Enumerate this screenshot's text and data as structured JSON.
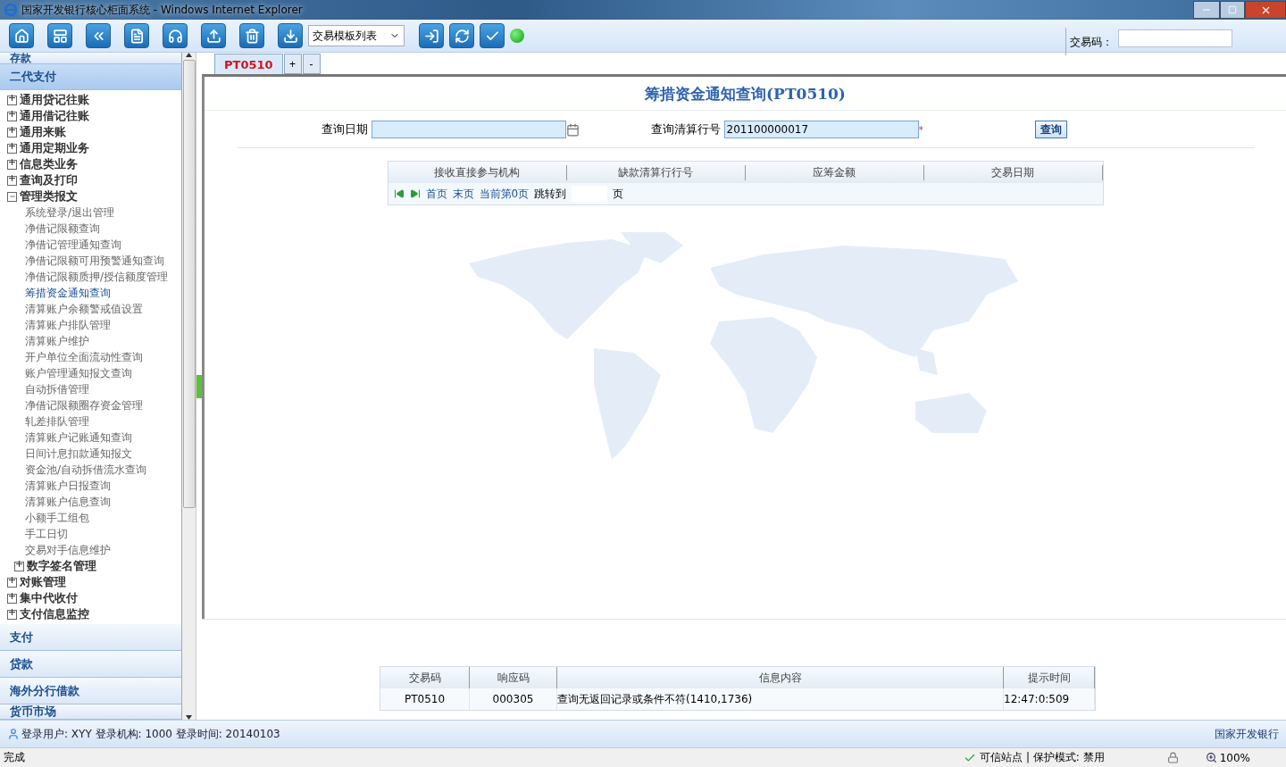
{
  "window": {
    "title": "国家开发银行核心柜面系统 - Windows Internet Explorer"
  },
  "toolbar": {
    "buttons": [
      {
        "kind": "home"
      },
      {
        "kind": "layout"
      },
      {
        "kind": "back"
      },
      {
        "kind": "document"
      },
      {
        "kind": "headset"
      },
      {
        "kind": "upload"
      },
      {
        "kind": "trash"
      },
      {
        "kind": "template"
      }
    ],
    "template_select": "交易模板列表",
    "actions": [
      {
        "kind": "enter"
      },
      {
        "kind": "refresh"
      },
      {
        "kind": "confirm"
      }
    ],
    "status_online": true,
    "code_label": "交易码："
  },
  "sidebar": {
    "top_section": "存款",
    "active_section": "二代支付",
    "tree": [
      {
        "label": "通用贷记往账",
        "expanded": false
      },
      {
        "label": "通用借记往账",
        "expanded": false
      },
      {
        "label": "通用来账",
        "expanded": false
      },
      {
        "label": "通用定期业务",
        "expanded": false
      },
      {
        "label": "信息类业务",
        "expanded": false
      },
      {
        "label": "查询及打印",
        "expanded": false
      },
      {
        "label": "管理类报文",
        "expanded": true,
        "children": [
          {
            "label": "系统登录/退出管理",
            "selected": false
          },
          {
            "label": "净借记限额查询",
            "selected": false
          },
          {
            "label": "净借记管理通知查询",
            "selected": false
          },
          {
            "label": "净借记限额可用预警通知查询",
            "selected": false
          },
          {
            "label": "净借记限额质押/授信额度管理",
            "selected": false
          },
          {
            "label": "筹措资金通知查询",
            "selected": true
          },
          {
            "label": "清算账户余额警戒值设置",
            "selected": false
          },
          {
            "label": "清算账户排队管理",
            "selected": false
          },
          {
            "label": "清算账户维护",
            "selected": false
          },
          {
            "label": "开户单位全面流动性查询",
            "selected": false
          },
          {
            "label": "账户管理通知报文查询",
            "selected": false
          },
          {
            "label": "自动拆借管理",
            "selected": false
          },
          {
            "label": "净借记限额圈存资金管理",
            "selected": false
          },
          {
            "label": "轧差排队管理",
            "selected": false
          },
          {
            "label": "清算账户记账通知查询",
            "selected": false
          },
          {
            "label": "日间计息扣款通知报文",
            "selected": false
          },
          {
            "label": "资金池/自动拆借流水查询",
            "selected": false
          },
          {
            "label": "清算账户日报查询",
            "selected": false
          },
          {
            "label": "清算账户信息查询",
            "selected": false
          },
          {
            "label": "小额手工组包",
            "selected": false
          },
          {
            "label": "手工日切",
            "selected": false
          },
          {
            "label": "交易对手信息维护",
            "selected": false
          },
          {
            "label": "数字签名管理",
            "expanded": false
          }
        ]
      },
      {
        "label": "对账管理",
        "expanded": false
      },
      {
        "label": "集中代收付",
        "expanded": false
      },
      {
        "label": "支付信息监控",
        "expanded": false
      }
    ],
    "sections": [
      "支付",
      "贷款",
      "海外分行借款",
      "货币市场"
    ]
  },
  "tabs": [
    {
      "label": "PT0510",
      "selected": true
    }
  ],
  "tab_buttons": [
    "+",
    "-"
  ],
  "form": {
    "title": "筹措资金通知查询(PT0510)",
    "date_label": "查询日期",
    "bank_label": "查询清算行号",
    "bank_value": "201100000017",
    "required_mark": "*",
    "query_button": "查询"
  },
  "grid": {
    "columns": [
      "接收直接参与机构",
      "缺款清算行行号",
      "应筹金额",
      "交易日期"
    ],
    "pager": {
      "first": "首页",
      "last": "末页",
      "current": "当前第0页",
      "jump_label": "跳转到",
      "unit": "页"
    }
  },
  "messages": {
    "columns": [
      "交易码",
      "响应码",
      "信息内容",
      "提示时间"
    ],
    "rows": [
      [
        "PT0510",
        "000305",
        "查询无返回记录或条件不符(1410,1736)",
        "12:47:0:509"
      ]
    ]
  },
  "login_bar": {
    "info": "登录用户: XYY 登录机构: 1000 登录时间: 20140103",
    "bank": "国家开发银行"
  },
  "status_bar": {
    "status": "完成",
    "zone": "可信站点 | 保护模式: 禁用",
    "zoom": "100%"
  }
}
